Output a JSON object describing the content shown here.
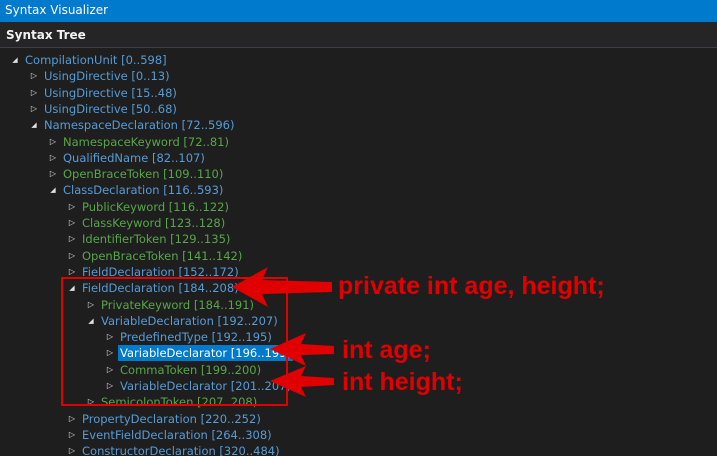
{
  "window": {
    "title": "Syntax Visualizer"
  },
  "panel": {
    "title": "Syntax Tree"
  },
  "tree": [
    {
      "label": "CompilationUnit [0..598]",
      "depth": 0,
      "expanded": true,
      "kind": "node"
    },
    {
      "label": "UsingDirective [0..13)",
      "depth": 1,
      "expanded": false,
      "kind": "node"
    },
    {
      "label": "UsingDirective [15..48)",
      "depth": 1,
      "expanded": false,
      "kind": "node"
    },
    {
      "label": "UsingDirective [50..68)",
      "depth": 1,
      "expanded": false,
      "kind": "node"
    },
    {
      "label": "NamespaceDeclaration [72..596)",
      "depth": 1,
      "expanded": true,
      "kind": "node"
    },
    {
      "label": "NamespaceKeyword [72..81)",
      "depth": 2,
      "expanded": false,
      "kind": "token"
    },
    {
      "label": "QualifiedName [82..107)",
      "depth": 2,
      "expanded": false,
      "kind": "node"
    },
    {
      "label": "OpenBraceToken [109..110)",
      "depth": 2,
      "expanded": false,
      "kind": "token"
    },
    {
      "label": "ClassDeclaration [116..593)",
      "depth": 2,
      "expanded": true,
      "kind": "node"
    },
    {
      "label": "PublicKeyword [116..122)",
      "depth": 3,
      "expanded": false,
      "kind": "token"
    },
    {
      "label": "ClassKeyword [123..128)",
      "depth": 3,
      "expanded": false,
      "kind": "token"
    },
    {
      "label": "IdentifierToken [129..135)",
      "depth": 3,
      "expanded": false,
      "kind": "token"
    },
    {
      "label": "OpenBraceToken [141..142)",
      "depth": 3,
      "expanded": false,
      "kind": "token"
    },
    {
      "label": "FieldDeclaration [152..172)",
      "depth": 3,
      "expanded": false,
      "kind": "node"
    },
    {
      "label": "FieldDeclaration [184..208)",
      "depth": 3,
      "expanded": true,
      "kind": "node"
    },
    {
      "label": "PrivateKeyword [184..191)",
      "depth": 4,
      "expanded": false,
      "kind": "token"
    },
    {
      "label": "VariableDeclaration [192..207)",
      "depth": 4,
      "expanded": true,
      "kind": "node"
    },
    {
      "label": "PredefinedType [192..195)",
      "depth": 5,
      "expanded": false,
      "kind": "node"
    },
    {
      "label": "VariableDeclarator [196..199)",
      "depth": 5,
      "expanded": false,
      "kind": "node",
      "selected": true
    },
    {
      "label": "CommaToken [199..200)",
      "depth": 5,
      "expanded": false,
      "kind": "token"
    },
    {
      "label": "VariableDeclarator [201..207)",
      "depth": 5,
      "expanded": false,
      "kind": "node"
    },
    {
      "label": "SemicolonToken [207..208)",
      "depth": 4,
      "expanded": false,
      "kind": "token"
    },
    {
      "label": "PropertyDeclaration [220..252)",
      "depth": 3,
      "expanded": false,
      "kind": "node"
    },
    {
      "label": "EventFieldDeclaration [264..308)",
      "depth": 3,
      "expanded": false,
      "kind": "node"
    },
    {
      "label": "ConstructorDeclaration [320..484)",
      "depth": 3,
      "expanded": false,
      "kind": "node"
    }
  ],
  "annotations": {
    "field": "private int age, height;",
    "age": "int age;",
    "height": "int height;"
  },
  "colors": {
    "node": "#569cd6",
    "token": "#57a64a",
    "selection": "#007acc",
    "annotation": "#e00000"
  }
}
